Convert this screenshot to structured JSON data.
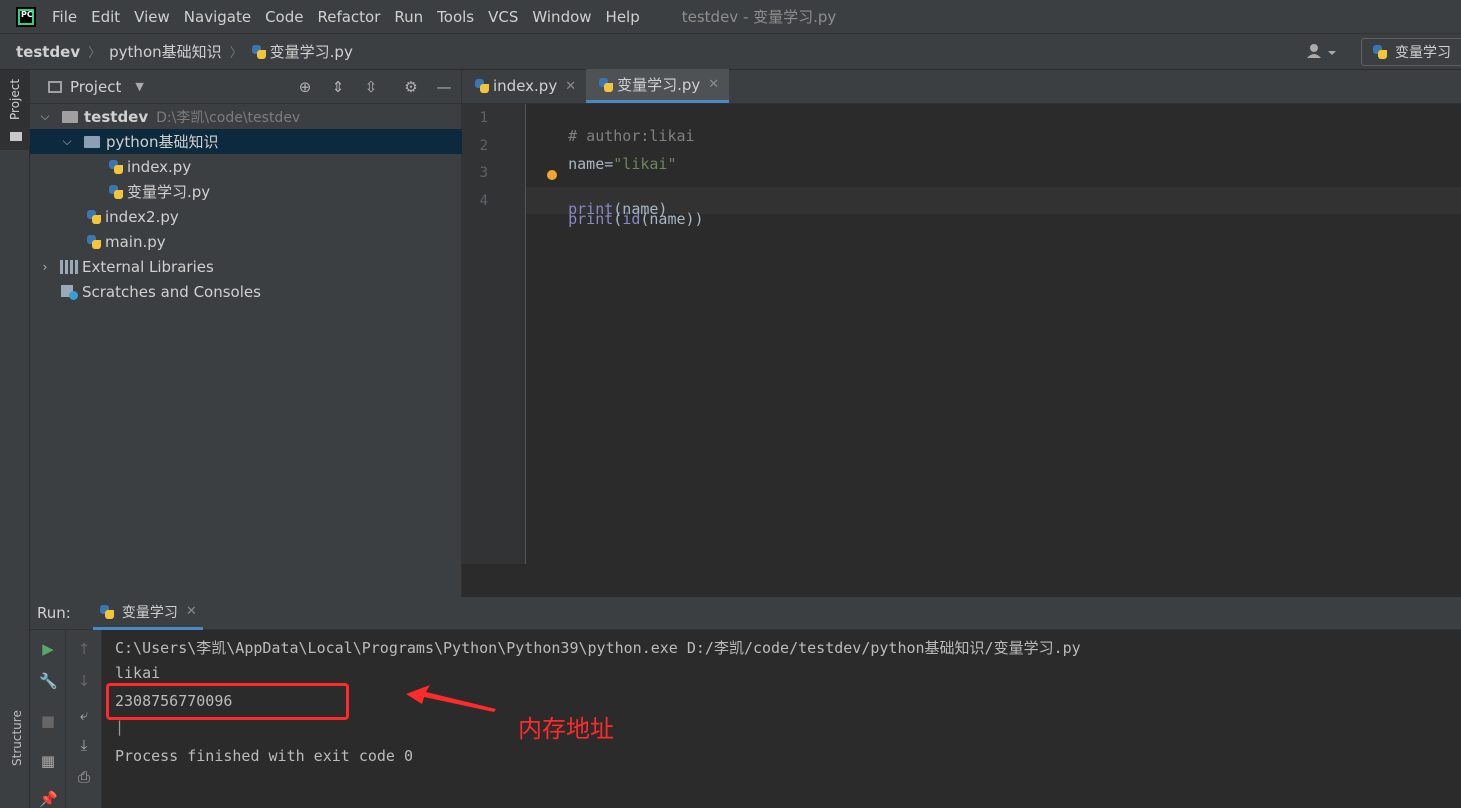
{
  "menubar": {
    "logo_text": "PC",
    "items": [
      "File",
      "Edit",
      "View",
      "Navigate",
      "Code",
      "Refactor",
      "Run",
      "Tools",
      "VCS",
      "Window",
      "Help"
    ],
    "title": "testdev - 变量学习.py"
  },
  "breadcrumb": {
    "items": [
      "testdev",
      "python基础知识",
      "变量学习.py"
    ],
    "run_config": "变量学习"
  },
  "left_strip": {
    "project_label": "Project",
    "structure_label": "Structure"
  },
  "project_panel": {
    "title": "Project",
    "tree": {
      "root": "testdev",
      "root_path": "D:\\李凯\\code\\testdev",
      "folder": "python基础知识",
      "files_in_folder": [
        "index.py",
        "变量学习.py"
      ],
      "root_files": [
        "index2.py",
        "main.py"
      ],
      "external": "External Libraries",
      "scratches": "Scratches and Consoles"
    }
  },
  "editor": {
    "tabs": [
      {
        "label": "index.py",
        "active": false
      },
      {
        "label": "变量学习.py",
        "active": true
      }
    ],
    "line_numbers": [
      "1",
      "2",
      "3",
      "4"
    ],
    "code": {
      "l1": "# author:likai",
      "l2_var": "name",
      "l2_eq": "=",
      "l2_str": "\"likai\"",
      "l3_fn": "print",
      "l3_args": "(name)",
      "l4_fn1": "print",
      "l4_p1": "(",
      "l4_fn2": "id",
      "l4_args": "(name))"
    }
  },
  "run_panel": {
    "label": "Run:",
    "tab": "变量学习",
    "console": [
      "C:\\Users\\李凯\\AppData\\Local\\Programs\\Python\\Python39\\python.exe D:/李凯/code/testdev/python基础知识/变量学习.py",
      "likai",
      "2308756770096",
      "|",
      "Process finished with exit code 0"
    ]
  },
  "annotation": {
    "text": "内存地址",
    "color": "#ff2a2a"
  },
  "colors": {
    "accent": "#4a88c7",
    "selection": "#0d293e",
    "run_green": "#59a869"
  }
}
